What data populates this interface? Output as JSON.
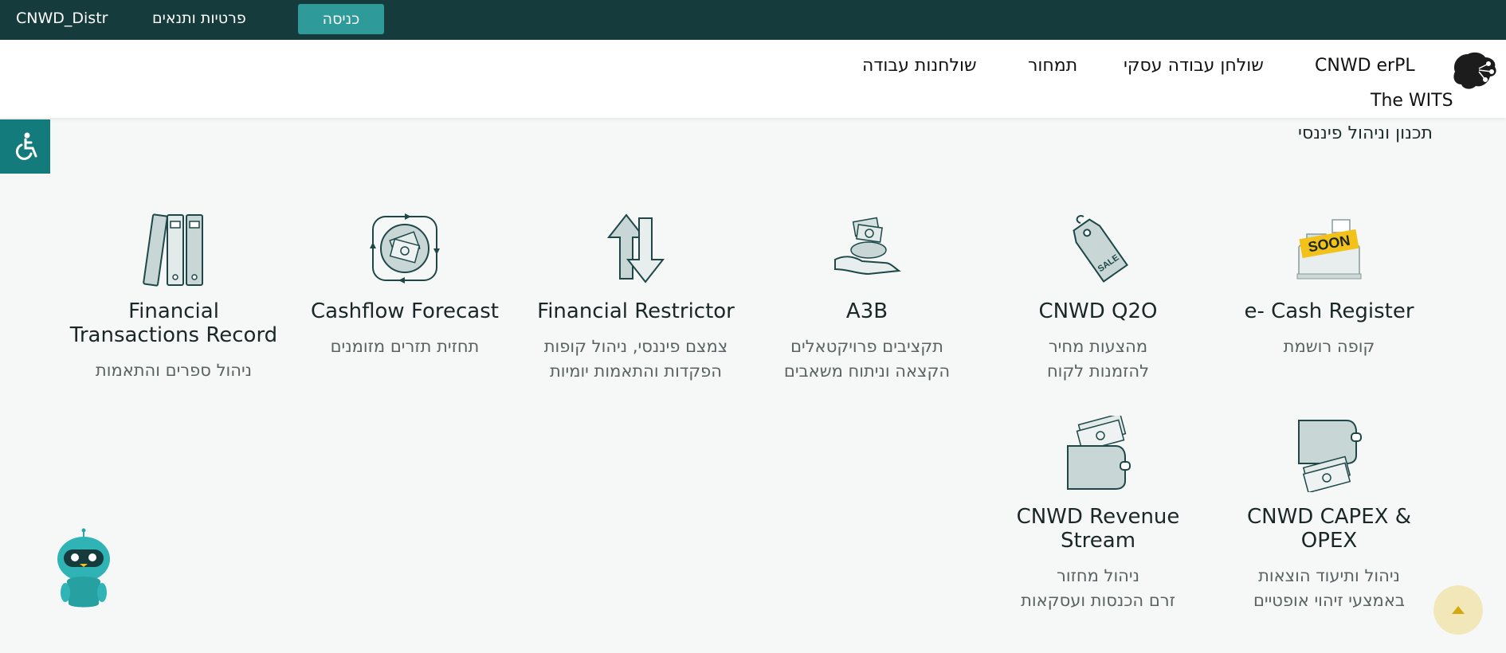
{
  "topbar": {
    "brand": "CNWD_Distr",
    "terms_link": "פרטיות ותנאים",
    "login_button": "כניסה"
  },
  "nav": {
    "items": [
      "CNWD erPL",
      "שולחן עבודה עסקי",
      "תמחור",
      "שולחנות עבודה"
    ],
    "second_row": "The WITS"
  },
  "section": {
    "title": "תכנון וניהול פיננסי"
  },
  "cards": [
    {
      "icon": "cash-register-soon-icon",
      "title": "e- Cash Register",
      "desc": "קופה רושמת"
    },
    {
      "icon": "sale-tag-icon",
      "title": "CNWD Q2O",
      "desc": "מהצעות מחיר\nלהזמנות לקוח"
    },
    {
      "icon": "hand-money-icon",
      "title": "A3B",
      "desc": "תקציבים פרויקטאלים\nהקצאה וניתוח משאבים"
    },
    {
      "icon": "up-down-arrows-icon",
      "title": "Financial Restrictor",
      "desc": "צמצם פיננסי, ניהול קופות\nהפקדות והתאמות יומיות"
    },
    {
      "icon": "cash-cycle-icon",
      "title": "Cashflow Forecast",
      "desc": "תחזית תזרים מזומנים"
    },
    {
      "icon": "binders-icon",
      "title": "Financial\nTransactions Record",
      "desc": "ניהול ספרים והתאמות"
    },
    {
      "icon": "wallet-icon",
      "title": "CNWD CAPEX &\nOPEX",
      "desc": "ניהול ותיעוד הוצאות\nבאמצעי זיהוי אופטיים"
    },
    {
      "icon": "wallet-cash-icon",
      "title": "CNWD Revenue\nStream",
      "desc": "ניהול מחזור\nזרם הכנסות ועסקאות"
    }
  ],
  "colors": {
    "topbar": "#163b3d",
    "accent": "#2f9a9a",
    "accessibility": "#137b7b",
    "scrolltop": "#f2e7b9"
  }
}
